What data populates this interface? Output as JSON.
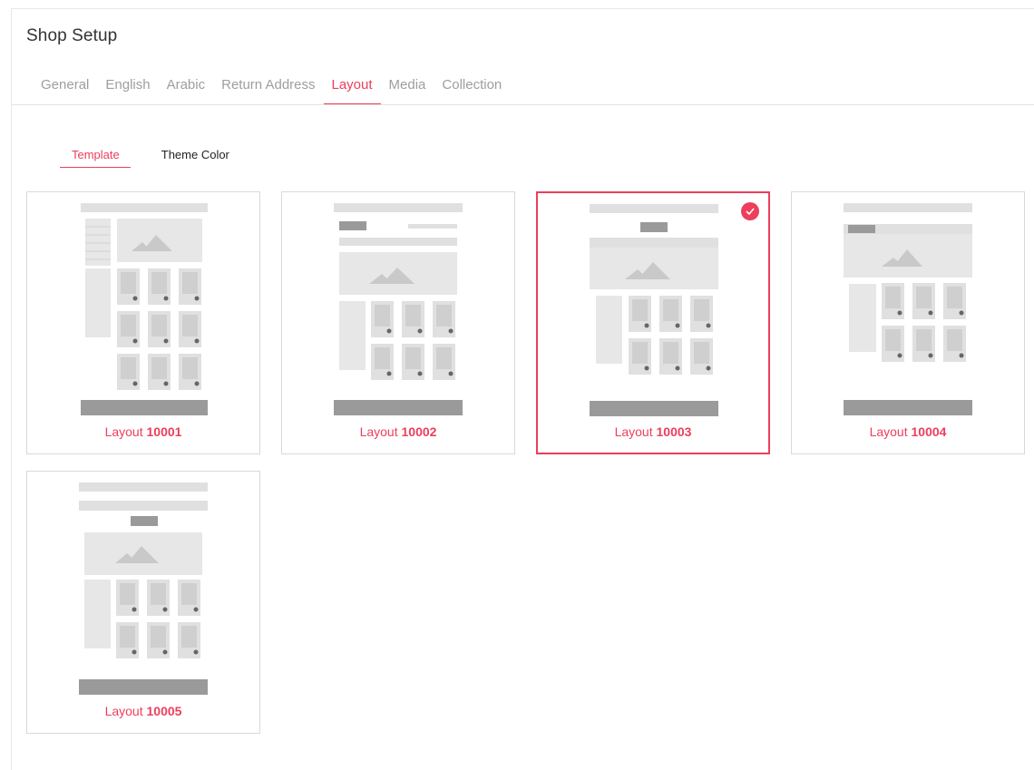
{
  "header": {
    "title": "Shop Setup"
  },
  "tabs": [
    {
      "label": "General",
      "active": false
    },
    {
      "label": "English",
      "active": false
    },
    {
      "label": "Arabic",
      "active": false
    },
    {
      "label": "Return Address",
      "active": false
    },
    {
      "label": "Layout",
      "active": true
    },
    {
      "label": "Media",
      "active": false
    },
    {
      "label": "Collection",
      "active": false
    }
  ],
  "subtabs": [
    {
      "label": "Template",
      "active": true
    },
    {
      "label": "Theme Color",
      "active": false
    }
  ],
  "layouts": [
    {
      "prefix": "Layout",
      "number": "10001",
      "selected": false
    },
    {
      "prefix": "Layout",
      "number": "10002",
      "selected": false
    },
    {
      "prefix": "Layout",
      "number": "10003",
      "selected": true
    },
    {
      "prefix": "Layout",
      "number": "10004",
      "selected": false
    },
    {
      "prefix": "Layout",
      "number": "10005",
      "selected": false
    }
  ],
  "colors": {
    "accent": "#ed3e5c",
    "placeholder_light": "#e0e0e0",
    "placeholder_dark": "#9a9a9a"
  },
  "icons": {
    "selected_badge": "check-icon"
  }
}
